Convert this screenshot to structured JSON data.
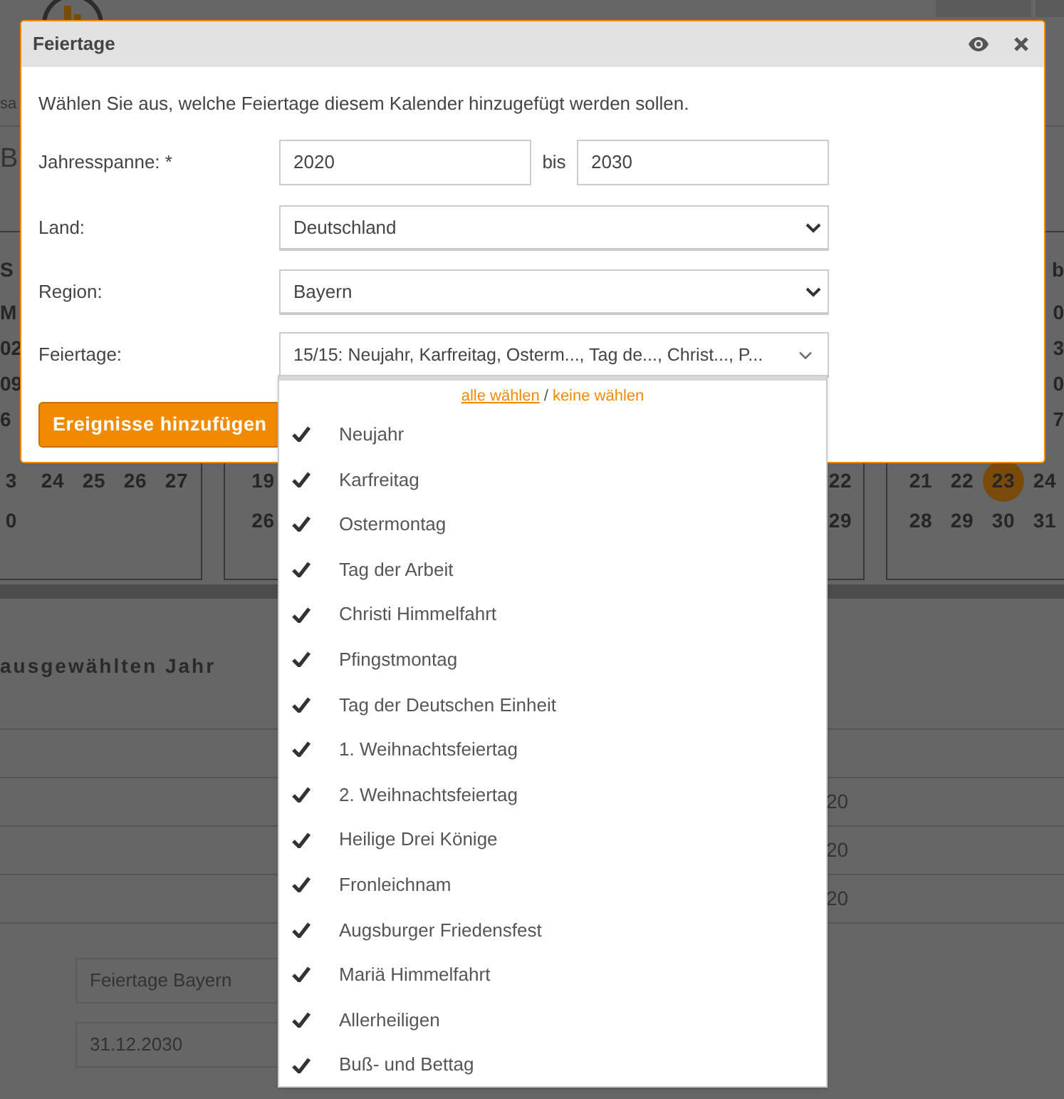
{
  "background": {
    "tab_fragment": "sa",
    "title_fragment": "B",
    "calendars": [
      {
        "kind": "left",
        "header": "S",
        "edge_labels": [
          "M",
          "02",
          "09",
          "6"
        ],
        "weeks": [
          [
            "3",
            "24",
            "25",
            "26",
            "27"
          ],
          [
            "0"
          ]
        ]
      },
      {
        "kind": "middle",
        "weeks": [
          [
            "19",
            "22"
          ],
          [
            "26",
            "29"
          ]
        ]
      },
      {
        "kind": "right",
        "header": "b",
        "edge_labels": [
          "0",
          "3",
          "0",
          "7"
        ],
        "weeks": [
          [
            {
              "day": "21",
              "selected": false
            },
            {
              "day": "22",
              "selected": false
            },
            {
              "day": "23",
              "selected": true
            },
            {
              "day": "24",
              "selected": false
            }
          ],
          [
            {
              "day": "28",
              "selected": false
            },
            {
              "day": "29",
              "selected": false
            },
            {
              "day": "30",
              "selected": false
            },
            {
              "day": "31",
              "selected": false
            }
          ]
        ]
      }
    ],
    "section_heading": "ausgewählten Jahr",
    "table_rows": [
      {
        "cell": null
      },
      {
        "cell": "20"
      },
      {
        "cell": "20"
      },
      {
        "cell": "20"
      }
    ],
    "fields": [
      "Feiertage Bayern",
      "31.12.2030"
    ]
  },
  "dialog": {
    "title": "Feiertage",
    "description": "Wählen Sie aus, welche Feiertage diesem Kalender hinzugefügt werden sollen.",
    "year_span": {
      "label": "Jahresspanne: *",
      "from": "2020",
      "separator": "bis",
      "to": "2030"
    },
    "country": {
      "label": "Land:",
      "value": "Deutschland"
    },
    "region": {
      "label": "Region:",
      "value": "Bayern"
    },
    "holidays": {
      "label": "Feiertage:",
      "value": "15/15: Neujahr, Karfreitag, Osterm..., Tag de..., Christ..., P...",
      "expanded": true
    },
    "submit": "Ereignisse hinzufügen"
  },
  "dropdown": {
    "select_all": "alle wählen",
    "separator": "/",
    "select_none": "keine wählen",
    "items": [
      {
        "label": "Neujahr",
        "checked": true
      },
      {
        "label": "Karfreitag",
        "checked": true
      },
      {
        "label": "Ostermontag",
        "checked": true
      },
      {
        "label": "Tag der Arbeit",
        "checked": true
      },
      {
        "label": "Christi Himmelfahrt",
        "checked": true
      },
      {
        "label": "Pfingstmontag",
        "checked": true
      },
      {
        "label": "Tag der Deutschen Einheit",
        "checked": true
      },
      {
        "label": "1. Weihnachtsfeiertag",
        "checked": true
      },
      {
        "label": "2. Weihnachtsfeiertag",
        "checked": true
      },
      {
        "label": "Heilige Drei Könige",
        "checked": true
      },
      {
        "label": "Fronleichnam",
        "checked": true
      },
      {
        "label": "Augsburger Friedensfest",
        "checked": true
      },
      {
        "label": "Mariä Himmelfahrt",
        "checked": true
      },
      {
        "label": "Allerheiligen",
        "checked": true
      },
      {
        "label": "Buß- und Bettag",
        "checked": true
      }
    ]
  }
}
